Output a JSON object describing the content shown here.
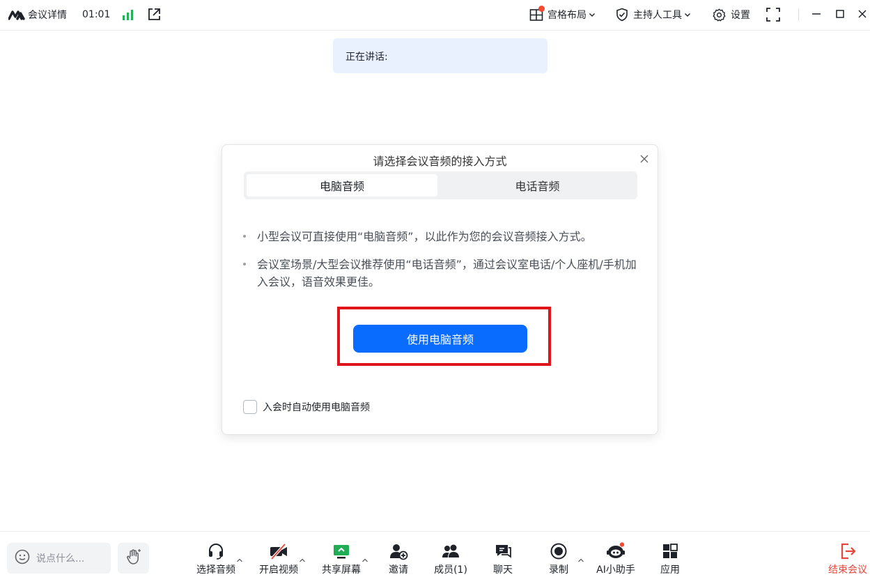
{
  "topbar": {
    "meeting_details": "会议详情",
    "timer": "01:01",
    "layout_label": "宫格布局",
    "host_tools_label": "主持人工具",
    "settings_label": "设置"
  },
  "speaking": {
    "label": "正在讲话:"
  },
  "dialog": {
    "title": "请选择会议音频的接入方式",
    "tabs": [
      {
        "label": "电脑音频",
        "active": true
      },
      {
        "label": "电话音频",
        "active": false
      }
    ],
    "bullets": [
      "小型会议可直接使用“电脑音频”，以此作为您的会议音频接入方式。",
      "会议室场景/大型会议推荐使用“电话音频”，通过会议室电话/个人座机/手机加入会议，语音效果更佳。"
    ],
    "primary_button": "使用电脑音频",
    "auto_checkbox_label": "入会时自动使用电脑音频",
    "auto_checkbox_checked": false
  },
  "bottombar": {
    "chat_placeholder": "说点什么...",
    "tools": {
      "audio": "选择音频",
      "video": "开启视频",
      "share": "共享屏幕",
      "invite": "邀请",
      "members": "成员(1)",
      "chat": "聊天",
      "record": "录制",
      "ai": "AI小助手",
      "apps": "应用",
      "end": "结束会议"
    }
  },
  "colors": {
    "accent": "#0a6cff",
    "share_green": "#1fad55",
    "signal_green": "#27b05a",
    "end_red": "#e8453c",
    "badge_red": "#f24b31",
    "highlight_frame": "#e0151b",
    "speaking_bg": "#e9f1ff"
  },
  "icons": {
    "logo": "app-logo-icon",
    "signal": "signal-bars-icon",
    "share_out": "external-link-icon",
    "layout": "grid-layout-icon",
    "host": "shield-check-icon",
    "settings": "gear-icon",
    "fullscreen": "fullscreen-icon",
    "minimize": "minimize-icon",
    "maximize": "maximize-icon",
    "close": "close-icon"
  }
}
